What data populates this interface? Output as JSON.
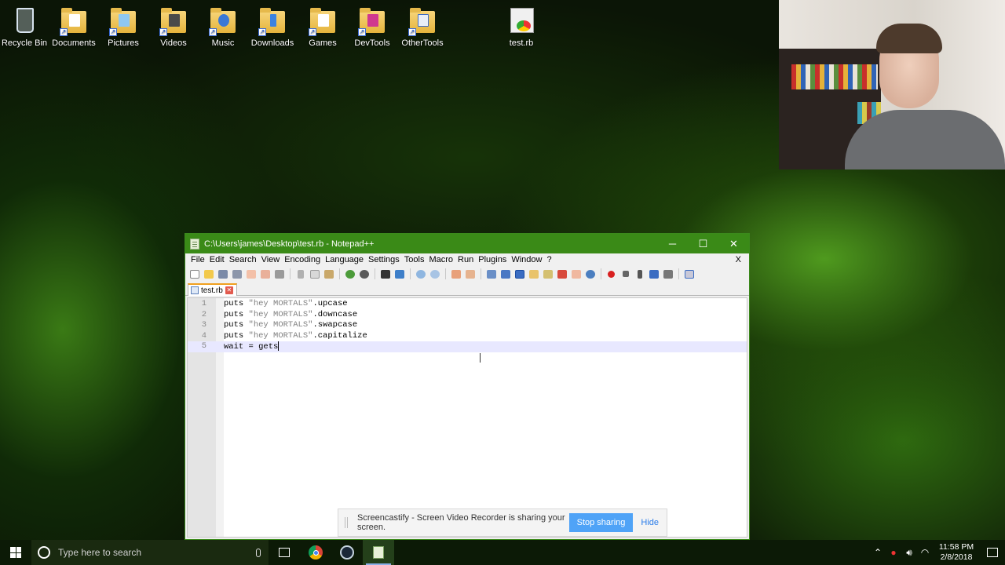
{
  "desktop": {
    "icons": [
      {
        "label": "Recycle Bin",
        "icon": "recycle-bin-icon"
      },
      {
        "label": "Documents",
        "icon": "documents-folder-icon"
      },
      {
        "label": "Pictures",
        "icon": "pictures-folder-icon"
      },
      {
        "label": "Videos",
        "icon": "videos-folder-icon"
      },
      {
        "label": "Music",
        "icon": "music-folder-icon"
      },
      {
        "label": "Downloads",
        "icon": "downloads-folder-icon"
      },
      {
        "label": "Games",
        "icon": "games-folder-icon"
      },
      {
        "label": "DevTools",
        "icon": "devtools-folder-icon"
      },
      {
        "label": "OtherTools",
        "icon": "othertools-folder-icon"
      },
      {
        "label": "test.rb",
        "icon": "ruby-file-icon"
      }
    ]
  },
  "notepad": {
    "title": "C:\\Users\\james\\Desktop\\test.rb - Notepad++",
    "menus": [
      "File",
      "Edit",
      "Search",
      "View",
      "Encoding",
      "Language",
      "Settings",
      "Tools",
      "Macro",
      "Run",
      "Plugins",
      "Window",
      "?"
    ],
    "menu_close": "X",
    "tab_label": "test.rb",
    "lines": [
      {
        "num": "1",
        "pre": "puts ",
        "str": "\"hey MORTALS\"",
        "post": ".upcase"
      },
      {
        "num": "2",
        "pre": "puts ",
        "str": "\"hey MORTALS\"",
        "post": ".downcase"
      },
      {
        "num": "3",
        "pre": "puts ",
        "str": "\"hey MORTALS\"",
        "post": ".swapcase"
      },
      {
        "num": "4",
        "pre": "puts ",
        "str": "\"hey MORTALS\"",
        "post": ".capitalize"
      },
      {
        "num": "5",
        "pre": "wait = gets",
        "str": "",
        "post": ""
      }
    ]
  },
  "screencastify": {
    "message": "Screencastify - Screen Video Recorder is sharing your screen.",
    "stop_label": "Stop sharing",
    "hide_label": "Hide"
  },
  "taskbar": {
    "search_placeholder": "Type here to search",
    "time": "11:58 PM",
    "date": "2/8/2018"
  },
  "colors": {
    "titlebar": "#3a8a17",
    "stop_button": "#4fa3f7"
  }
}
